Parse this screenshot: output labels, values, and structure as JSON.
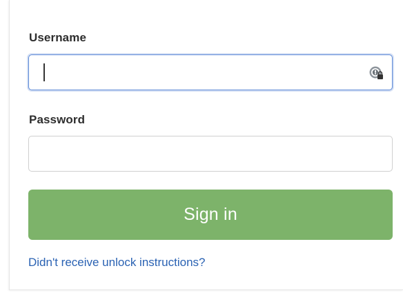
{
  "form": {
    "username_label": "Username",
    "username_value": "",
    "password_label": "Password",
    "password_value": "",
    "signin_label": "Sign in",
    "unlock_link": "Didn't receive unlock instructions?"
  },
  "icons": {
    "password_manager": "password-manager-key-lock-icon"
  },
  "colors": {
    "button_bg": "#7db36a",
    "link": "#2a62b3",
    "focus_border": "#5b88d6"
  }
}
